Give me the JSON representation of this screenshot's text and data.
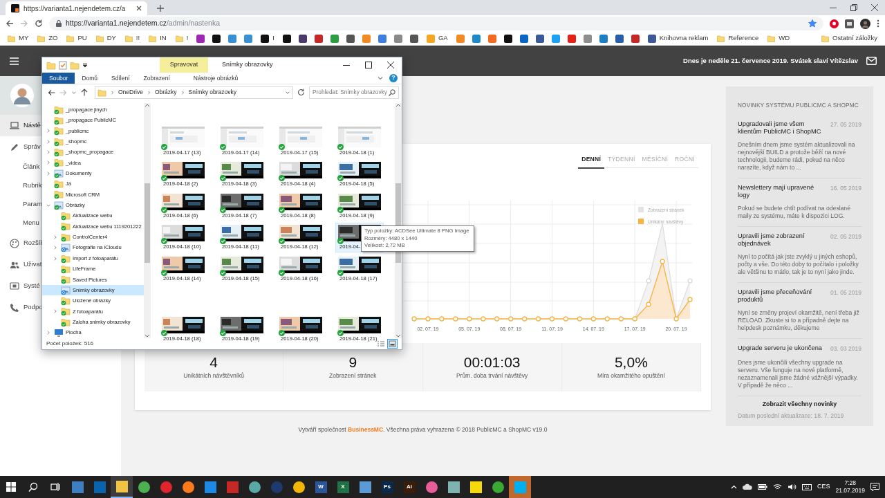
{
  "browser": {
    "tab": {
      "title": "https://varianta1.nejendetem.cz/a",
      "selected": true
    },
    "address": {
      "origin": "https://varianta1.nejendetem.cz",
      "path": "/admin/nastenka",
      "bookmarked": true
    },
    "bookmarks": [
      {
        "kind": "folder",
        "label": "MY"
      },
      {
        "kind": "folder",
        "label": "ZO"
      },
      {
        "kind": "folder",
        "label": "PU"
      },
      {
        "kind": "folder",
        "label": "DY"
      },
      {
        "kind": "folder",
        "label": "!!"
      },
      {
        "kind": "folder",
        "label": "IN"
      },
      {
        "kind": "folder",
        "label": "!"
      },
      {
        "kind": "site",
        "color": "#9c27b0"
      },
      {
        "kind": "site",
        "color": "#111111"
      },
      {
        "kind": "site",
        "color": "#3b8fd4"
      },
      {
        "kind": "site",
        "color": "#3b8fd4"
      },
      {
        "kind": "site",
        "color": "#111111",
        "label": "I"
      },
      {
        "kind": "site",
        "color": "#111111"
      },
      {
        "kind": "site",
        "color": "#4a3b6b"
      },
      {
        "kind": "site",
        "color": "#c62828"
      },
      {
        "kind": "site",
        "color": "#2e9e44"
      },
      {
        "kind": "site",
        "color": "#555555"
      },
      {
        "kind": "site",
        "color": "#f08a24"
      },
      {
        "kind": "site",
        "color": "#3f7fe0"
      },
      {
        "kind": "site",
        "color": "#8a8a8a"
      },
      {
        "kind": "site",
        "color": "#555555"
      },
      {
        "kind": "site",
        "color": "#f5a623",
        "label": "GA"
      },
      {
        "kind": "site",
        "color": "#f08a24"
      },
      {
        "kind": "site",
        "color": "#1e88c8"
      },
      {
        "kind": "site",
        "color": "#f26b21"
      },
      {
        "kind": "site",
        "color": "#111111"
      },
      {
        "kind": "site",
        "color": "#0a66c2"
      },
      {
        "kind": "site",
        "color": "#3b5998"
      },
      {
        "kind": "site",
        "color": "#1da1f2"
      },
      {
        "kind": "site",
        "color": "#e62117"
      },
      {
        "kind": "site",
        "color": "#8e8e8e"
      },
      {
        "kind": "site",
        "color": "#1e7fc8"
      },
      {
        "kind": "site",
        "color": "#2a5fa8"
      },
      {
        "kind": "site",
        "color": "#c62828"
      },
      {
        "kind": "site",
        "color": "#3b5998",
        "label": "Knihovna reklam"
      },
      {
        "kind": "folder",
        "label": "Reference"
      },
      {
        "kind": "folder",
        "label": "WD"
      }
    ],
    "other_bookmarks": {
      "kind": "folder",
      "label": "Ostatní záložky"
    }
  },
  "header": {
    "date_text": "Dnes je neděle 21. července 2019. Svátek slaví Vítězslav"
  },
  "sidebar": [
    {
      "kind": "section",
      "label": "Nástě",
      "selected": true
    },
    {
      "kind": "section",
      "label": "Správ",
      "selected": false
    },
    {
      "kind": "sub",
      "label": "Článk",
      "selected": false
    },
    {
      "kind": "sub",
      "label": "Rubrik",
      "selected": false
    },
    {
      "kind": "sub",
      "label": "Param",
      "selected": false
    },
    {
      "kind": "sub",
      "label": "Menu",
      "selected": false
    },
    {
      "kind": "section",
      "label": "Rozšíř",
      "selected": false
    },
    {
      "kind": "section",
      "label": "Uživat",
      "selected": false
    },
    {
      "kind": "section",
      "label": "Systé",
      "selected": false
    },
    {
      "kind": "section",
      "label": "Podpo",
      "selected": false
    }
  ],
  "period_tabs": [
    {
      "label": "DENNÍ",
      "selected": true
    },
    {
      "label": "TÝDENNÍ",
      "selected": false
    },
    {
      "label": "MĚSÍČNÍ",
      "selected": false
    },
    {
      "label": "ROČNÍ",
      "selected": false
    }
  ],
  "chart": {
    "legend": [
      {
        "label": "Zobrazení stránek",
        "color": "#e3e3e3"
      },
      {
        "label": "Unikátní návštěvy",
        "color": "#f7b446"
      }
    ],
    "x_labels": [
      "02. 07. 19",
      "05. 07. 19",
      "08. 07. 19",
      "11. 07. 19",
      "14. 07. 19",
      "17. 07. 19",
      "20. 07. 19"
    ]
  },
  "stats": [
    {
      "value": "4",
      "label": "Unikátních návštěvníků"
    },
    {
      "value": "9",
      "label": "Zobrazení stránek"
    },
    {
      "value": "00:01:03",
      "label": "Prům. doba trvání návštěvy"
    },
    {
      "value": "5,0%",
      "label": "Míra okamžitého opuštění"
    }
  ],
  "footer": {
    "before": "Vytváří společnost ",
    "brand": "BusinessMC",
    "after": ". Všechna práva vyhrazena © 2018 PublicMC a ShopMC v19.0"
  },
  "news": {
    "title": "NOVINKY SYSTÉMU PUBLICMC A SHOPMC",
    "items": [
      {
        "title": "Upgradovali jsme všem klientům PublicMC i ShopMC",
        "date": "27. 05 2019",
        "text": "Dnešním dnem jsme systém aktualizovali na nejnovější BUILD a protože běží na nové technologii, budeme rádi, pokud na něco narazíte, když nám to ..."
      },
      {
        "title": "Newslettery mají upravené logy",
        "date": "16. 05 2019",
        "text": "Pokud se budete chtít podívat na odeslané maily ze systému, máte k dispozici LOG."
      },
      {
        "title": "Upravili jsme zobrazení objednávek",
        "date": "02. 05 2019",
        "text": "Nyní to počítá jak jste zvyklý u jiných eshopů, počty a vše. Do této doby to počítalo i položky ale většinu to mátlo, tak je to nyní jako jinde."
      },
      {
        "title": "Upravili jsme přeceňování produktů",
        "date": "01. 05 2019",
        "text": "Nyní se změny projeví okamžitě, není třeba již RELOAD. Zkuste si to a případně dejte na helpdesk poznámku, děkujeme"
      },
      {
        "title": "Upgrade serveru je ukončena",
        "date": "03. 03 2019",
        "text": "Dnes jsme ukončili všechny upgrade na serveru. Vše funguje na nové platformě, nezaznamenali jsme žádné vážnější výpadky. V případě že něco ..."
      }
    ],
    "more_link": "Zobrazit všechny novinky",
    "updated": "Datum poslední aktualizace: 18. 7. 2019"
  },
  "explorer": {
    "title": "Snímky obrazovky",
    "context_group": "Spravovat",
    "ribbon_tabs": [
      {
        "kind": "file",
        "label": "Soubor"
      },
      {
        "kind": "tab",
        "label": "Domů"
      },
      {
        "kind": "tab",
        "label": "Sdílení"
      },
      {
        "kind": "tab",
        "label": "Zobrazení"
      },
      {
        "kind": "context",
        "label": "Nástroje obrázků"
      }
    ],
    "help": "?",
    "breadcrumbs": [
      "OneDrive",
      "Obrázky",
      "Snímky obrazovky"
    ],
    "search": {
      "placeholder": "Prohledat: Snímky obrazovky"
    },
    "tree": [
      {
        "label": "_propagace jinych",
        "kind": "folder",
        "synced": true,
        "syncing": false,
        "expandable": false,
        "selected": false
      },
      {
        "label": "_propagace PublicMC",
        "kind": "folder",
        "synced": true,
        "syncing": false,
        "expandable": false,
        "selected": false
      },
      {
        "label": "_publicmc",
        "kind": "folder",
        "synced": true,
        "syncing": false,
        "expandable": true,
        "expanded": false,
        "selected": false
      },
      {
        "label": "_shopmc",
        "kind": "folder",
        "synced": true,
        "syncing": false,
        "expandable": true,
        "expanded": false,
        "selected": false
      },
      {
        "label": "_shopmc_propagace",
        "kind": "folder",
        "synced": true,
        "syncing": false,
        "expandable": true,
        "expanded": false,
        "selected": false
      },
      {
        "label": "_videa",
        "kind": "folder",
        "synced": true,
        "syncing": false,
        "expandable": true,
        "expanded": false,
        "selected": false
      },
      {
        "label": "Dokumenty",
        "kind": "library",
        "synced": true,
        "syncing": false,
        "expandable": true,
        "expanded": false,
        "selected": false
      },
      {
        "label": "Já",
        "kind": "folder",
        "synced": true,
        "syncing": false,
        "expandable": false,
        "selected": false
      },
      {
        "label": "Microsoft CRM",
        "kind": "folder",
        "synced": true,
        "syncing": false,
        "expandable": false,
        "selected": false
      },
      {
        "label": "Obrázky",
        "kind": "library",
        "synced": true,
        "syncing": false,
        "expandable": true,
        "expanded": true,
        "selected": false,
        "children": [
          {
            "label": "Aktualizace webu",
            "kind": "folder",
            "synced": true,
            "syncing": false,
            "expandable": false,
            "selected": false
          },
          {
            "label": "Aktualizace webu 1119201222",
            "kind": "folder",
            "synced": true,
            "syncing": false,
            "expandable": false,
            "selected": false
          },
          {
            "label": "ControlCenter4",
            "kind": "folder",
            "synced": true,
            "syncing": false,
            "expandable": true,
            "expanded": false,
            "selected": false
          },
          {
            "label": "Fotografie na iCloudu",
            "kind": "library",
            "synced": false,
            "syncing": true,
            "expandable": true,
            "expanded": false,
            "selected": false
          },
          {
            "label": "Import z fotoaparátu",
            "kind": "folder",
            "synced": true,
            "syncing": false,
            "expandable": true,
            "expanded": false,
            "selected": false
          },
          {
            "label": "LifeFrame",
            "kind": "folder",
            "synced": true,
            "syncing": false,
            "expandable": false,
            "selected": false
          },
          {
            "label": "Saved Pictures",
            "kind": "folder",
            "synced": true,
            "syncing": false,
            "expandable": false,
            "selected": false
          },
          {
            "label": "Snímky obrazovky",
            "kind": "library",
            "synced": false,
            "syncing": true,
            "expandable": false,
            "selected": true
          },
          {
            "label": "Uložené obrázky",
            "kind": "folder",
            "synced": true,
            "syncing": false,
            "expandable": false,
            "selected": false
          },
          {
            "label": "Z fotoaparátu",
            "kind": "folder",
            "synced": true,
            "syncing": false,
            "expandable": true,
            "expanded": false,
            "selected": false
          },
          {
            "label": "Zaloha snimky obrazovky",
            "kind": "folder",
            "synced": true,
            "syncing": false,
            "expandable": false,
            "selected": false
          }
        ]
      },
      {
        "label": "Plocha",
        "kind": "desktop",
        "synced": false,
        "syncing": false,
        "expandable": true,
        "expanded": false,
        "selected": false
      }
    ],
    "file_rows": [
      {
        "items": [
          {
            "label": "2019-04-17 (13)",
            "synced": true,
            "selected": false
          },
          {
            "label": "2019-04-17 (14)",
            "synced": true,
            "selected": false
          },
          {
            "label": "2019-04-17 (15)",
            "synced": true,
            "selected": false
          },
          {
            "label": "2019-04-18 (1)",
            "synced": true,
            "selected": false
          }
        ]
      },
      {
        "items": [
          {
            "label": "2019-04-18 (2)",
            "synced": true,
            "selected": false
          },
          {
            "label": "2019-04-18 (3)",
            "synced": true,
            "selected": false
          },
          {
            "label": "2019-04-18 (4)",
            "synced": true,
            "selected": false
          },
          {
            "label": "2019-04-18 (5)",
            "synced": true,
            "selected": false
          }
        ]
      },
      {
        "items": [
          {
            "label": "2019-04-18 (6)",
            "synced": true,
            "selected": false
          },
          {
            "label": "2019-04-18 (7)",
            "synced": true,
            "selected": false
          },
          {
            "label": "2019-04-18 (8)",
            "synced": true,
            "selected": false
          },
          {
            "label": "2019-04-18 (9)",
            "synced": true,
            "selected": false
          }
        ]
      },
      {
        "items": [
          {
            "label": "2019-04-18 (10)",
            "synced": true,
            "selected": false
          },
          {
            "label": "2019-04-18 (11)",
            "synced": true,
            "selected": false
          },
          {
            "label": "2019-04-18 (12)",
            "synced": true,
            "selected": false
          },
          {
            "label": "2019-04-",
            "synced": true,
            "selected": true
          }
        ]
      },
      {
        "items": [
          {
            "label": "2019-04-18 (14)",
            "synced": true,
            "selected": false
          },
          {
            "label": "2019-04-18 (15)",
            "synced": true,
            "selected": false
          },
          {
            "label": "2019-04-18 (16)",
            "synced": true,
            "selected": false
          },
          {
            "label": "2019-04-18 (17)",
            "synced": true,
            "selected": false
          }
        ]
      },
      {
        "gap_before": true,
        "items": [
          {
            "label": "2019-04-18 (18)",
            "synced": true,
            "selected": false
          },
          {
            "label": "2019-04-18 (19)",
            "synced": true,
            "selected": false
          },
          {
            "label": "2019-04-18 (20)",
            "synced": true,
            "selected": false
          },
          {
            "label": "2019-04-18 (21)",
            "synced": true,
            "selected": false
          }
        ]
      }
    ],
    "tooltip": [
      "Typ položky: ACDSee Ultimate 8 PNG Image",
      "Rozměry: 4480 x 1440",
      "Velikost: 2,72 MB"
    ],
    "status": "Počet položek: 516",
    "views": [
      {
        "kind": "details",
        "selected": false
      },
      {
        "kind": "large_icons",
        "selected": true
      }
    ]
  },
  "taskbar": {
    "apps": [
      {
        "kind": "square",
        "color": "#3d7fc1",
        "selected": false,
        "flashing": false
      },
      {
        "kind": "square",
        "color": "#0a64ad",
        "selected": false,
        "flashing": false
      },
      {
        "kind": "square",
        "color": "#f2c443",
        "selected": true,
        "flashing": false
      },
      {
        "kind": "circle",
        "color": "#4caf50",
        "selected": false,
        "flashing": false
      },
      {
        "kind": "circle",
        "color": "#e0242b",
        "selected": false,
        "flashing": false
      },
      {
        "kind": "circle",
        "color": "#ff7a1a",
        "selected": false,
        "flashing": false
      },
      {
        "kind": "square",
        "color": "#1e88e5",
        "selected": false,
        "flashing": false
      },
      {
        "kind": "square",
        "color": "#c62828",
        "selected": false,
        "flashing": false
      },
      {
        "kind": "circle",
        "color": "#5aa9a6",
        "selected": false,
        "flashing": false
      },
      {
        "kind": "circle",
        "color": "#1d3b6e",
        "selected": false,
        "flashing": false
      },
      {
        "kind": "circle",
        "color": "#f2b705",
        "selected": false,
        "flashing": false
      },
      {
        "kind": "square",
        "color": "#2b579a",
        "label": "W",
        "selected": false,
        "flashing": false
      },
      {
        "kind": "square",
        "color": "#217346",
        "label": "X",
        "selected": false,
        "flashing": false
      },
      {
        "kind": "square",
        "color": "#5b9bd5",
        "selected": false,
        "flashing": false
      },
      {
        "kind": "square",
        "color": "#0b2a4a",
        "label": "Ps",
        "selected": false,
        "flashing": false
      },
      {
        "kind": "square",
        "color": "#3b1d0a",
        "label": "Ai",
        "selected": false,
        "flashing": false
      },
      {
        "kind": "circle",
        "color": "#e85d9a",
        "selected": false,
        "flashing": false
      },
      {
        "kind": "square",
        "color": "#7fb3b0",
        "selected": false,
        "flashing": false
      },
      {
        "kind": "square",
        "color": "#f5d90a",
        "selected": false,
        "flashing": false
      },
      {
        "kind": "circle",
        "color": "#3aa935",
        "selected": false,
        "flashing": false
      },
      {
        "kind": "square",
        "color": "#00aff0",
        "selected": false,
        "flashing": true
      }
    ],
    "language": "CES",
    "time": "7:28",
    "date": "21.07.2019"
  }
}
